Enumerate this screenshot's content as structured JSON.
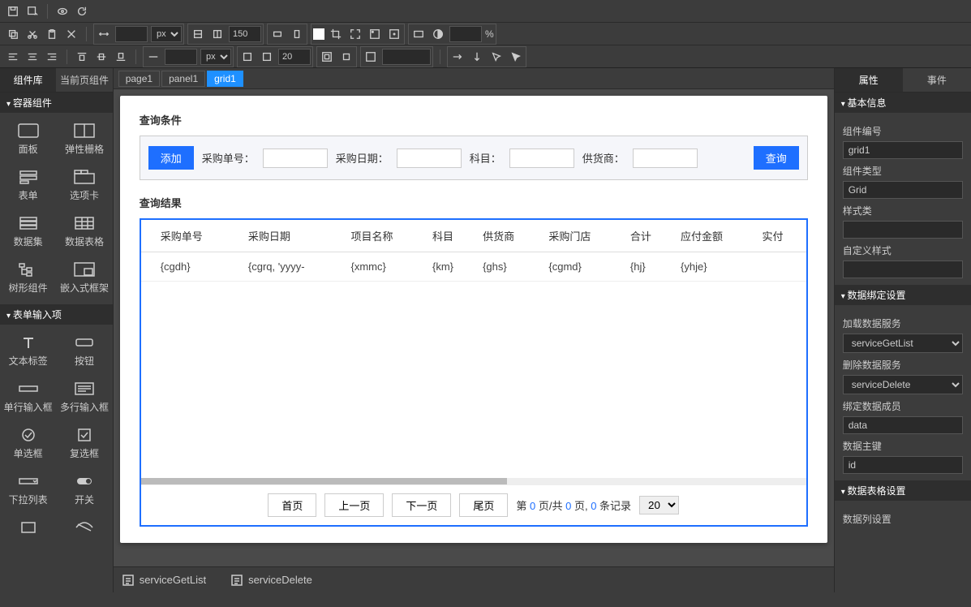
{
  "toolbar": {
    "row2": {
      "unit": "px",
      "width_val": "",
      "height_val": "150",
      "opacity_unit": "%"
    },
    "row3": {
      "unit": "px",
      "val1": "",
      "val2": "20"
    }
  },
  "left": {
    "tabs": [
      "组件库",
      "当前页组件"
    ],
    "sections": {
      "container": {
        "title": "容器组件",
        "items": [
          "面板",
          "弹性栅格",
          "表单",
          "选项卡",
          "数据集",
          "数据表格",
          "树形组件",
          "嵌入式框架"
        ]
      },
      "form": {
        "title": "表单输入项",
        "items": [
          "文本标签",
          "按钮",
          "单行输入框",
          "多行输入框",
          "单选框",
          "复选框",
          "下拉列表",
          "开关"
        ]
      }
    }
  },
  "breadcrumb": [
    "page1",
    "panel1",
    "grid1"
  ],
  "canvas": {
    "query_title": "查询条件",
    "add_btn": "添加",
    "fields": [
      "采购单号：",
      "采购日期：",
      "科目：",
      "供货商："
    ],
    "search_btn": "查询",
    "result_title": "查询结果",
    "columns": [
      "采购单号",
      "采购日期",
      "项目名称",
      "科目",
      "供货商",
      "采购门店",
      "合计",
      "应付金额",
      "实付"
    ],
    "row": [
      "{cgdh}",
      "{cgrq, 'yyyy-",
      "{xmmc}",
      "{km}",
      "{ghs}",
      "{cgmd}",
      "{hj}",
      "{yhje}",
      ""
    ],
    "pager": {
      "first": "首页",
      "prev": "上一页",
      "next": "下一页",
      "last": "尾页",
      "t1": "第 ",
      "t2": " 页/共 ",
      "t3": " 页, ",
      "t4": " 条记录",
      "p": "0",
      "pages": "0",
      "count": "0",
      "size": "20"
    }
  },
  "bottom": {
    "svc1": "serviceGetList",
    "svc2": "serviceDelete"
  },
  "right": {
    "tabs": [
      "属性",
      "事件"
    ],
    "s1": "基本信息",
    "s2": "数据绑定设置",
    "s3": "数据表格设置",
    "labels": {
      "id": "组件编号",
      "type": "组件类型",
      "styleClass": "样式类",
      "customStyle": "自定义样式",
      "loadSvc": "加载数据服务",
      "delSvc": "删除数据服务",
      "bindMember": "绑定数据成员",
      "pk": "数据主键",
      "colSetting": "数据列设置"
    },
    "values": {
      "id": "grid1",
      "type": "Grid",
      "styleClass": "",
      "customStyle": "",
      "loadSvc": "serviceGetList",
      "delSvc": "serviceDelete",
      "bindMember": "data",
      "pk": "id"
    }
  }
}
